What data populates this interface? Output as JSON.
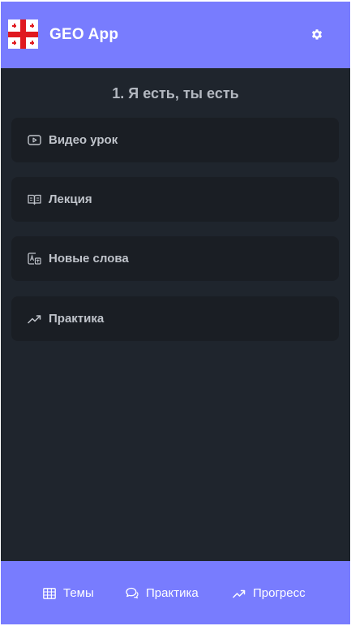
{
  "header": {
    "app_title": "GEO App",
    "logo_icon": "georgia-flag",
    "settings_icon": "gear-icon"
  },
  "lesson": {
    "title": "1. Я есть, ты есть"
  },
  "sections": [
    {
      "label": "Видео урок",
      "icon": "play-video-icon"
    },
    {
      "label": "Лекция",
      "icon": "open-book-icon"
    },
    {
      "label": "Новые слова",
      "icon": "translate-icon"
    },
    {
      "label": "Практика",
      "icon": "trend-up-icon"
    }
  ],
  "bottom_nav": {
    "items": [
      {
        "label": "Темы",
        "icon": "table-icon"
      },
      {
        "label": "Практика",
        "icon": "chat-icon"
      },
      {
        "label": "Прогресс",
        "icon": "trend-up-icon"
      }
    ]
  },
  "colors": {
    "accent": "#787cfe",
    "background": "#1f252d",
    "card": "#1a1e24",
    "text": "#bfc3ca",
    "flag_red": "#e0191f"
  }
}
